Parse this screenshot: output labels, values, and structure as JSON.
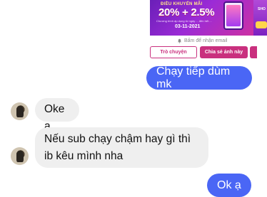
{
  "promo": {
    "eyebrow": "ĐIỀU KHUYẾN MÃI",
    "headline": "20% + 2.5%",
    "fine_print": "Chương trình áp dụng từ ngày ... đến hết ...",
    "date": "03-11-2021",
    "side_text": "SHO"
  },
  "shared_actions": {
    "email_hint": "Bấm để nhận email",
    "chat_button": "Trò chuyện",
    "share_photo_button": "Chia sẻ ảnh này"
  },
  "messages": [
    {
      "direction": "outgoing",
      "text": "Chạy tiếp dùm mk"
    },
    {
      "direction": "incoming",
      "text": "Oke ạ"
    },
    {
      "direction": "incoming",
      "text": "Nếu sub chạy chậm hay gì thì ib kêu mình nha"
    },
    {
      "direction": "outgoing",
      "text": "Ok ạ"
    }
  ],
  "colors": {
    "outgoing_bubble": "#4a66f5",
    "incoming_bubble": "#efefef",
    "brand_accent": "#c9307e"
  }
}
